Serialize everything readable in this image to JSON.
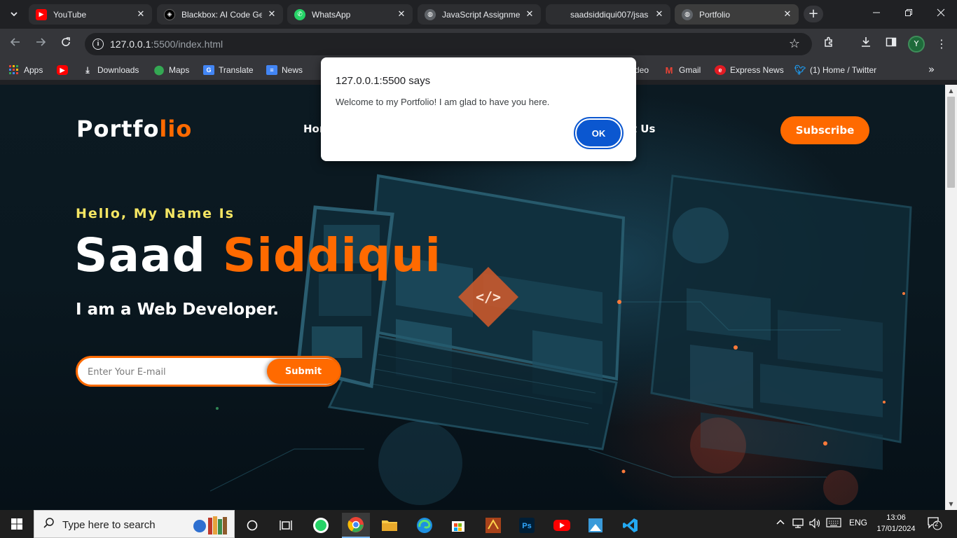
{
  "browser": {
    "tabs": [
      {
        "title": "YouTube",
        "icon": "youtube-icon",
        "color": "#ff0000"
      },
      {
        "title": "Blackbox: AI Code Ge",
        "icon": "blackbox-icon",
        "color": "#111111"
      },
      {
        "title": "WhatsApp",
        "icon": "whatsapp-icon",
        "color": "#25d366"
      },
      {
        "title": "JavaScript Assignmen",
        "icon": "globe-icon",
        "color": "#9aa0a6"
      },
      {
        "title": "saadsiddiqui007/jsas",
        "icon": "loading-icon",
        "color": "#9aa0a6"
      },
      {
        "title": "Portfolio",
        "icon": "globe-icon",
        "color": "#9aa0a6"
      }
    ],
    "new_tab_glyph": "+",
    "url": {
      "host": "127.0.0.1",
      "path": ":5500/index.html"
    },
    "bookmarks": [
      {
        "label": "Apps",
        "icon": "apps-grid-icon"
      },
      {
        "label": "",
        "icon": "youtube-icon"
      },
      {
        "label": "Downloads",
        "icon": "download-icon"
      },
      {
        "label": "Maps",
        "icon": "maps-pin-icon"
      },
      {
        "label": "Translate",
        "icon": "translate-icon"
      },
      {
        "label": "News",
        "icon": "news-icon"
      },
      {
        "label": "deo",
        "icon": ""
      },
      {
        "label": "Gmail",
        "icon": "gmail-icon"
      },
      {
        "label": "Express News",
        "icon": "express-news-icon"
      },
      {
        "label": "(1) Home / Twitter",
        "icon": "twitter-icon"
      }
    ],
    "profile_initial": "Y"
  },
  "page": {
    "logo_main": "Portfo",
    "logo_accent": "lio",
    "nav": {
      "home": "Hor",
      "contact": "ct Us"
    },
    "subscribe_label": "Subscribe",
    "greeting": "Hello, My Name Is",
    "first_name": "Saad",
    "last_name": "Siddiqui",
    "role": "I am a Web Developer.",
    "email_placeholder": "Enter Your E-mail",
    "submit_label": "Submit",
    "accent_color": "#ff6a00",
    "greeting_color": "#f5e663"
  },
  "dialog": {
    "title": "127.0.0.1:5500 says",
    "message": "Welcome to my Portfolio! I am glad to have you here.",
    "ok_label": "OK"
  },
  "taskbar": {
    "search_placeholder": "Type here to search",
    "apps": [
      "task-view-icon",
      "cortana-circle-icon",
      "whatsapp-icon",
      "chrome-icon",
      "file-explorer-icon",
      "edge-icon",
      "store-icon",
      "inpage-icon",
      "photoshop-icon",
      "youtube-icon",
      "paint-icon",
      "vscode-icon"
    ],
    "language": "ENG",
    "time": "13:06",
    "date": "17/01/2024",
    "notification_count": "2"
  }
}
